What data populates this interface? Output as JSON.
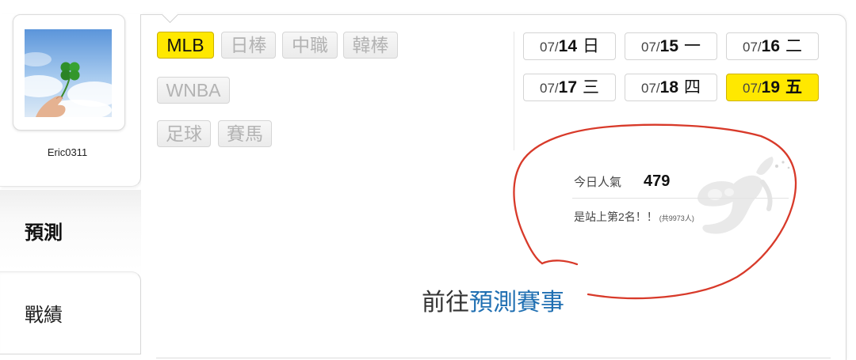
{
  "user": {
    "name": "Eric0311",
    "avatar": "clover-in-hand-photo"
  },
  "nav": {
    "items": [
      {
        "label": "預測",
        "active": true
      },
      {
        "label": "戰績",
        "active": false
      }
    ]
  },
  "sports": {
    "tags": [
      {
        "label": "MLB",
        "active": true
      },
      {
        "label": "日棒",
        "active": false
      },
      {
        "label": "中職",
        "active": false
      },
      {
        "label": "韓棒",
        "active": false
      },
      {
        "label": "WNBA",
        "active": false
      },
      {
        "label": "足球",
        "active": false
      },
      {
        "label": "賽馬",
        "active": false
      }
    ]
  },
  "dates": {
    "items": [
      {
        "prefix": "07/",
        "day": "14",
        "weekday": "日",
        "active": false
      },
      {
        "prefix": "07/",
        "day": "15",
        "weekday": "一",
        "active": false
      },
      {
        "prefix": "07/",
        "day": "16",
        "weekday": "二",
        "active": false
      },
      {
        "prefix": "07/",
        "day": "17",
        "weekday": "三",
        "active": false
      },
      {
        "prefix": "07/",
        "day": "18",
        "weekday": "四",
        "active": false
      },
      {
        "prefix": "07/",
        "day": "19",
        "weekday": "五",
        "active": true
      }
    ]
  },
  "popularity": {
    "label": "今日人氣",
    "value": "479",
    "rank_text": "是站上第2名！！",
    "total_text": "(共9973人)"
  },
  "cta": {
    "prefix": "前往",
    "link": "預測賽事"
  },
  "icons": {
    "watermark": "mascot-logo-watermark",
    "annotation": "red-hand-drawn-circle"
  },
  "colors": {
    "active_yellow": "#ffe800",
    "link_blue": "#1f6fb2",
    "annotation_red": "#d83a2a",
    "inactive_text": "#b3b3b3"
  }
}
